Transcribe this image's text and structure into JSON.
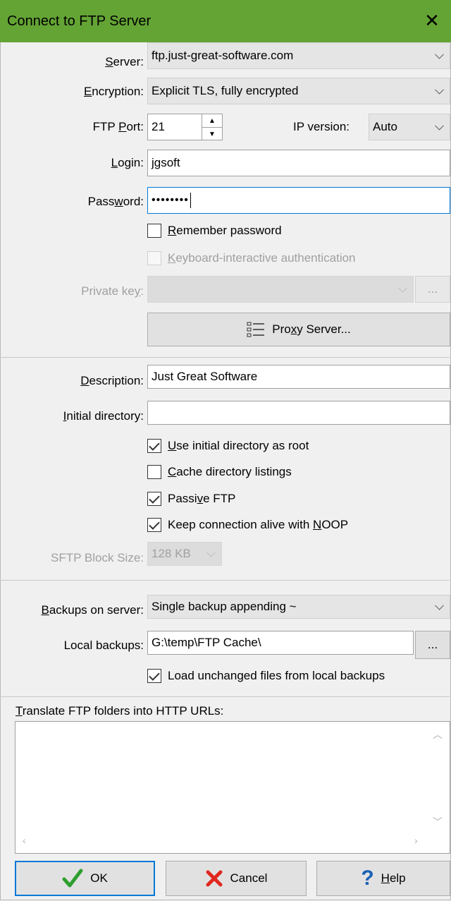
{
  "window": {
    "title": "Connect to FTP Server",
    "close_glyph": "✕"
  },
  "server": {
    "label_pre": "",
    "label_u": "S",
    "label_post": "erver:",
    "value": "ftp.just-great-software.com"
  },
  "encryption": {
    "label_pre": "",
    "label_u": "E",
    "label_post": "ncryption:",
    "value": "Explicit TLS, fully encrypted"
  },
  "port": {
    "label_pre": "FTP ",
    "label_u": "P",
    "label_post": "ort:",
    "value": "21"
  },
  "ip_version": {
    "label": "IP version:",
    "value": "Auto"
  },
  "login": {
    "label_pre": "",
    "label_u": "L",
    "label_post": "ogin:",
    "value": "jgsoft"
  },
  "password": {
    "label_pre": "Pass",
    "label_u": "w",
    "label_post": "ord:",
    "value": "••••••••"
  },
  "remember_password": {
    "label_u": "R",
    "label_post": "emember password",
    "checked": false
  },
  "keyboard_interactive": {
    "label_u": "K",
    "label_post": "eyboard-interactive authentication",
    "checked": false
  },
  "private_key": {
    "label_pre": "Private ke",
    "label_u": "y",
    "label_post": ":",
    "browse": "..."
  },
  "proxy": {
    "label_pre": "Pro",
    "label_u": "x",
    "label_post": "y Server..."
  },
  "description": {
    "label_pre": "",
    "label_u": "D",
    "label_post": "escription:",
    "value": "Just Great Software"
  },
  "initial_directory": {
    "label_pre": "",
    "label_u": "I",
    "label_post": "nitial directory:",
    "value": ""
  },
  "use_initial_root": {
    "label_pre": "",
    "label_u": "U",
    "label_post": "se initial directory as root",
    "checked": true
  },
  "cache_listings": {
    "label_pre": "",
    "label_u": "C",
    "label_post": "ache directory listings",
    "checked": false
  },
  "passive_ftp": {
    "label_pre": "Passi",
    "label_u": "v",
    "label_post": "e FTP",
    "checked": true
  },
  "keep_alive": {
    "label_pre": "Keep connection alive with ",
    "label_u": "N",
    "label_post": "OOP",
    "checked": true
  },
  "sftp_block": {
    "label": "SFTP Block Size:",
    "value": "128 KB"
  },
  "backups_server": {
    "label_pre": "",
    "label_u": "B",
    "label_post": "ackups on server:",
    "value": "Single backup appending ~"
  },
  "local_backups": {
    "label": "Local backups:",
    "value": "G:\\temp\\FTP Cache\\",
    "browse": "..."
  },
  "load_unchanged": {
    "label": "Load unchanged files from local backups",
    "checked": true
  },
  "translate": {
    "label_pre": "",
    "label_u": "T",
    "label_post": "ranslate FTP folders into HTTP URLs:"
  },
  "buttons": {
    "ok": "OK",
    "cancel": "Cancel",
    "help_pre": "",
    "help_u": "H",
    "help_post": "elp"
  }
}
